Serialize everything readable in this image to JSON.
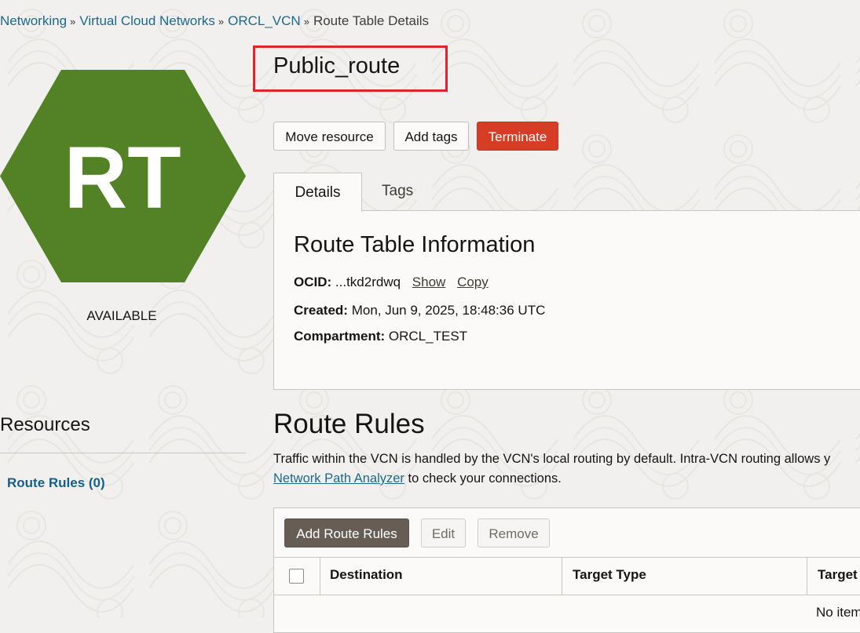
{
  "breadcrumb": {
    "items": [
      "Networking",
      "Virtual Cloud Networks",
      "ORCL_VCN"
    ],
    "current": "Route Table Details",
    "separator": "»"
  },
  "resource": {
    "icon_text": "RT",
    "icon_color": "#538126",
    "status": "AVAILABLE",
    "title": "Public_route"
  },
  "actions": {
    "move": "Move resource",
    "add_tags": "Add tags",
    "terminate": "Terminate"
  },
  "tabs": {
    "details": "Details",
    "tags": "Tags"
  },
  "info": {
    "title": "Route Table Information",
    "ocid_label": "OCID:",
    "ocid_value": "...tkd2rdwq",
    "show": "Show",
    "copy": "Copy",
    "created_label": "Created:",
    "created_value": "Mon, Jun 9, 2025, 18:48:36 UTC",
    "compartment_label": "Compartment:",
    "compartment_value": "ORCL_TEST"
  },
  "resources": {
    "title": "Resources",
    "items": [
      "Route Rules (0)"
    ]
  },
  "route_rules": {
    "title": "Route Rules",
    "desc_line1": "Traffic within the VCN is handled by the VCN's local routing by default. Intra-VCN routing allows y",
    "analyzer_link": "Network Path Analyzer",
    "desc_line2_rest": " to check your connections.",
    "add": "Add Route Rules",
    "edit": "Edit",
    "remove": "Remove",
    "columns": [
      "Destination",
      "Target Type",
      "Target"
    ],
    "empty": "No item"
  },
  "colors": {
    "terminate": "#d73d25",
    "primary_dark": "#665e55",
    "link": "#1a6a8f",
    "highlight_box": "#e02530"
  }
}
